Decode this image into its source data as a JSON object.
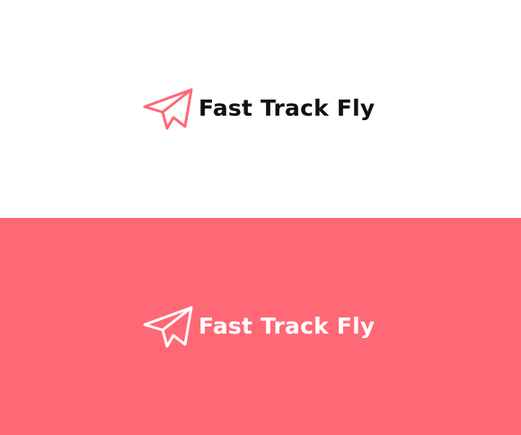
{
  "logo_light": {
    "brand_name": "Fast Track Fly",
    "icon": "paper-plane-icon",
    "background_color": "#ffffff",
    "icon_color": "#ff6875",
    "text_color": "#111111"
  },
  "logo_dark": {
    "brand_name": "Fast Track Fly",
    "icon": "paper-plane-icon",
    "background_color": "#ff6875",
    "icon_color": "#ffffff",
    "text_color": "#ffffff"
  }
}
